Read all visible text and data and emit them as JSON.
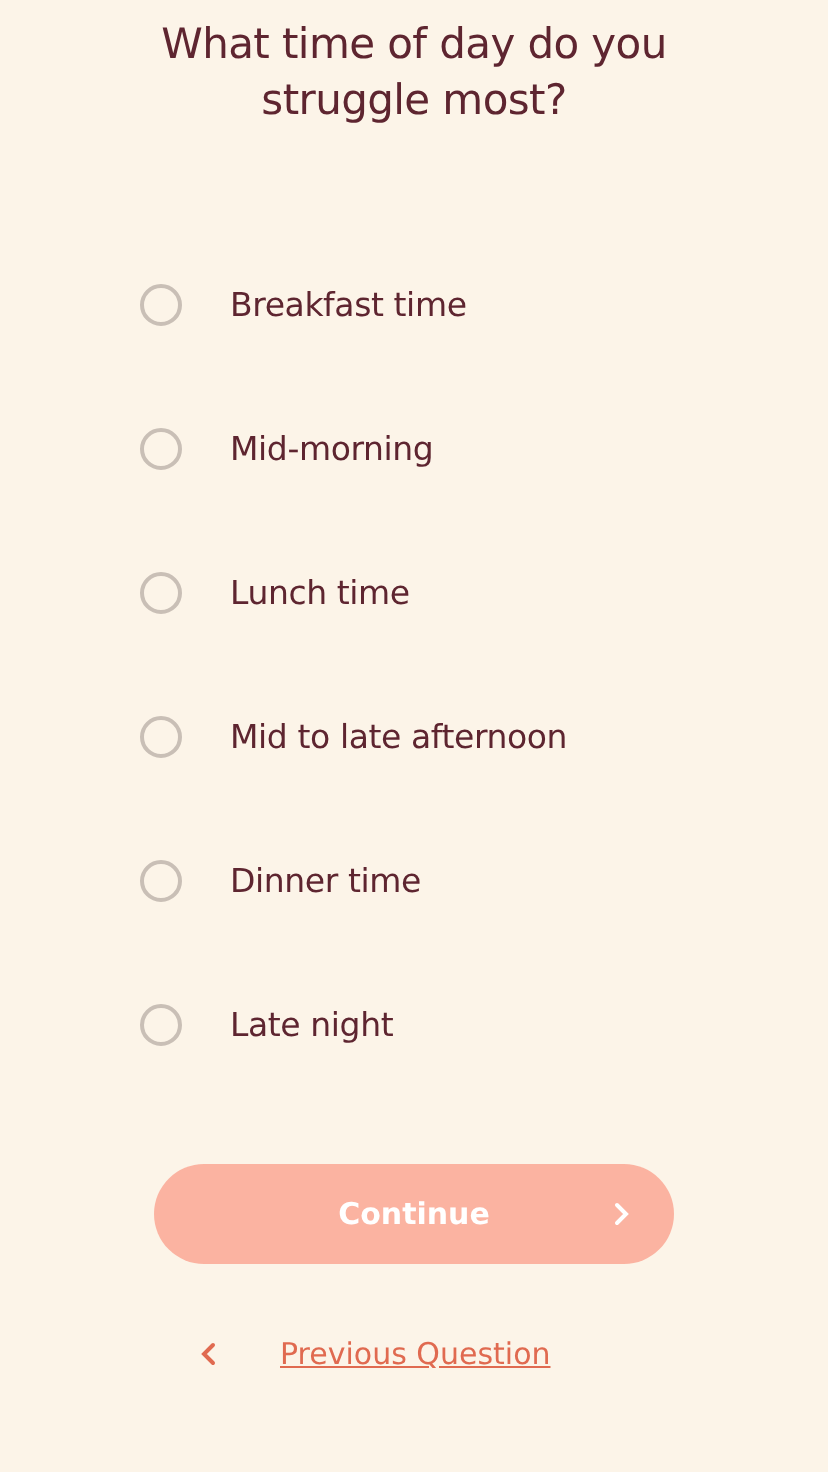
{
  "question": "What time of day do you struggle most?",
  "options": [
    {
      "label": "Breakfast time",
      "selected": false
    },
    {
      "label": "Mid-morning",
      "selected": false
    },
    {
      "label": "Lunch time",
      "selected": false
    },
    {
      "label": "Mid to late afternoon",
      "selected": false
    },
    {
      "label": "Dinner time",
      "selected": false
    },
    {
      "label": "Late night",
      "selected": false
    }
  ],
  "continue_button": {
    "label": "Continue",
    "disabled": true
  },
  "previous_link": {
    "label": "Previous Question"
  }
}
